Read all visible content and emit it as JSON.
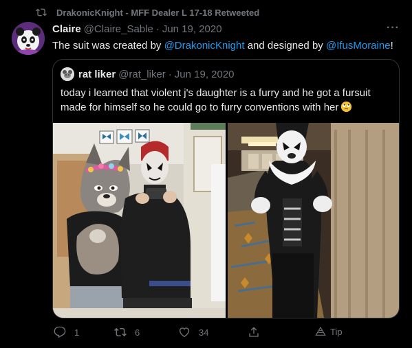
{
  "retweet": {
    "text": "DrakonicKnight - MFF Dealer L 17-18 Retweeted",
    "icon": "retweet-icon"
  },
  "author": {
    "display_name": "Claire",
    "handle": "@Claire_Sable",
    "separator": "·",
    "date": "Jun 19, 2020"
  },
  "more_label": "···",
  "tweet": {
    "text_1": "The suit was created by ",
    "mention_1": "@DrakonicKnight",
    "text_2": " and designed by ",
    "mention_2": "@IfusMoraine",
    "text_3": "!"
  },
  "quote": {
    "display_name": "rat liker",
    "handle": "@rat_liker",
    "separator": "·",
    "date": "Jun 19, 2020",
    "text": "today i learned that violent j's daughter is a furry and he got a fursuit made for himself so he could go to furry conventions with her",
    "emoji": "eye-roll-emoji"
  },
  "actions": {
    "reply_count": "1",
    "retweet_count": "6",
    "like_count": "34",
    "share_label": "",
    "tip_label": "Tip"
  },
  "colors": {
    "background": "#000000",
    "text_primary": "#e7e9ea",
    "text_secondary": "#71767b",
    "link": "#1d9bf0",
    "border": "#2f3336"
  }
}
